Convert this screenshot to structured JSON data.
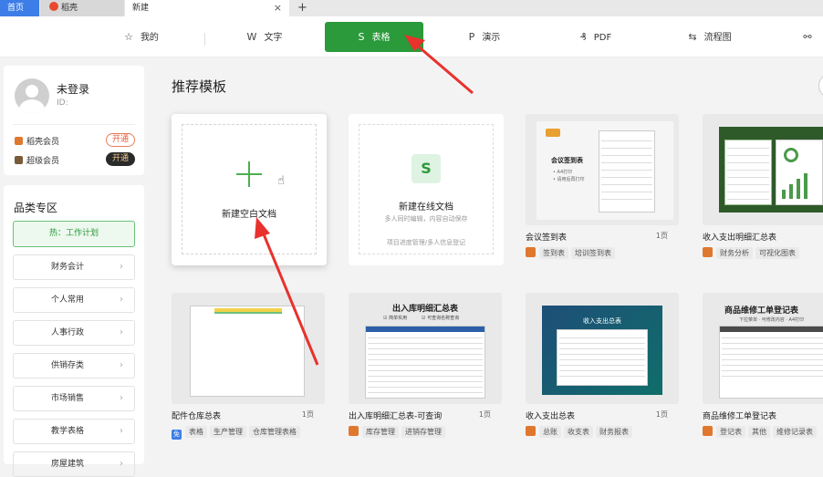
{
  "tabs": {
    "home": "首页",
    "daoke": "稻壳",
    "new": "新建",
    "close": "×",
    "add": "+"
  },
  "typenav": [
    {
      "label": "我的",
      "icon": "star-icon",
      "glyph": "☆"
    },
    {
      "label": "文字",
      "icon": "w-icon",
      "glyph": "W"
    },
    {
      "label": "表格",
      "icon": "s-icon",
      "glyph": "S"
    },
    {
      "label": "演示",
      "icon": "p-icon",
      "glyph": "P"
    },
    {
      "label": "PDF",
      "icon": "pdf-icon",
      "glyph": "₰"
    },
    {
      "label": "流程图",
      "icon": "flow-icon",
      "glyph": "⇆"
    },
    {
      "label": "",
      "icon": "share-icon",
      "glyph": "⚯"
    }
  ],
  "user": {
    "name": "未登录",
    "id": "ID:",
    "members": [
      {
        "label": "稻壳会员",
        "button": "开通"
      },
      {
        "label": "超级会员",
        "button": "开通"
      }
    ]
  },
  "categories": {
    "title": "品类专区",
    "hot": "热：工作计划",
    "items": [
      "财务会计",
      "个人常用",
      "人事行政",
      "供销存类",
      "市场销售",
      "教学表格",
      "房屋建筑"
    ]
  },
  "main": {
    "title": "推荐模板",
    "blank": {
      "label": "新建空白文档"
    },
    "online": {
      "icon_letter": "S",
      "title": "新建在线文档",
      "desc": "多人同时编辑，内容自动保存",
      "footer": "项目进度管理/多人信息登记"
    },
    "templates": [
      {
        "name": "会议签到表",
        "pages": "1页",
        "badge": "o",
        "tags": [
          "签到表",
          "培训签到表"
        ],
        "thumb_title": "会议签到表",
        "thumb_lines": [
          "• A4打印",
          "• 请用后再打印"
        ]
      },
      {
        "name": "收入支出明细汇总表",
        "pages": "",
        "badge": "o",
        "tags": [
          "财务分析",
          "可视化图表"
        ]
      },
      {
        "name": "配件仓库总表",
        "pages": "1页",
        "badge": "b",
        "badge_text": "免",
        "tags": [
          "表格",
          "生产管理",
          "仓库管理表格"
        ]
      },
      {
        "name": "出入库明细汇总表-可查询",
        "pages": "1页",
        "badge": "o",
        "tags": [
          "库存管理",
          "进销存管理"
        ],
        "thumb_title": "出入库明细汇总表",
        "thumb_sub": [
          "☑ 简单实用",
          "☑ 可查询名称查询"
        ]
      },
      {
        "name": "收入支出总表",
        "pages": "1页",
        "badge": "o",
        "tags": [
          "总账",
          "收支表",
          "财务报表"
        ],
        "thumb_title": "收入支出总表"
      },
      {
        "name": "商品维修工单登记表",
        "pages": "",
        "badge": "o",
        "tags": [
          "登记表",
          "其他",
          "维修记录表"
        ],
        "thumb_title": "商品维修工单登记表",
        "thumb_sub": [
          "下拉菜单 · 可修改内容 · A4打印"
        ]
      }
    ]
  },
  "colors": {
    "accent_green": "#2a9a3a",
    "tab_blue": "#3d7de8",
    "arrow_red": "#e8322c"
  }
}
